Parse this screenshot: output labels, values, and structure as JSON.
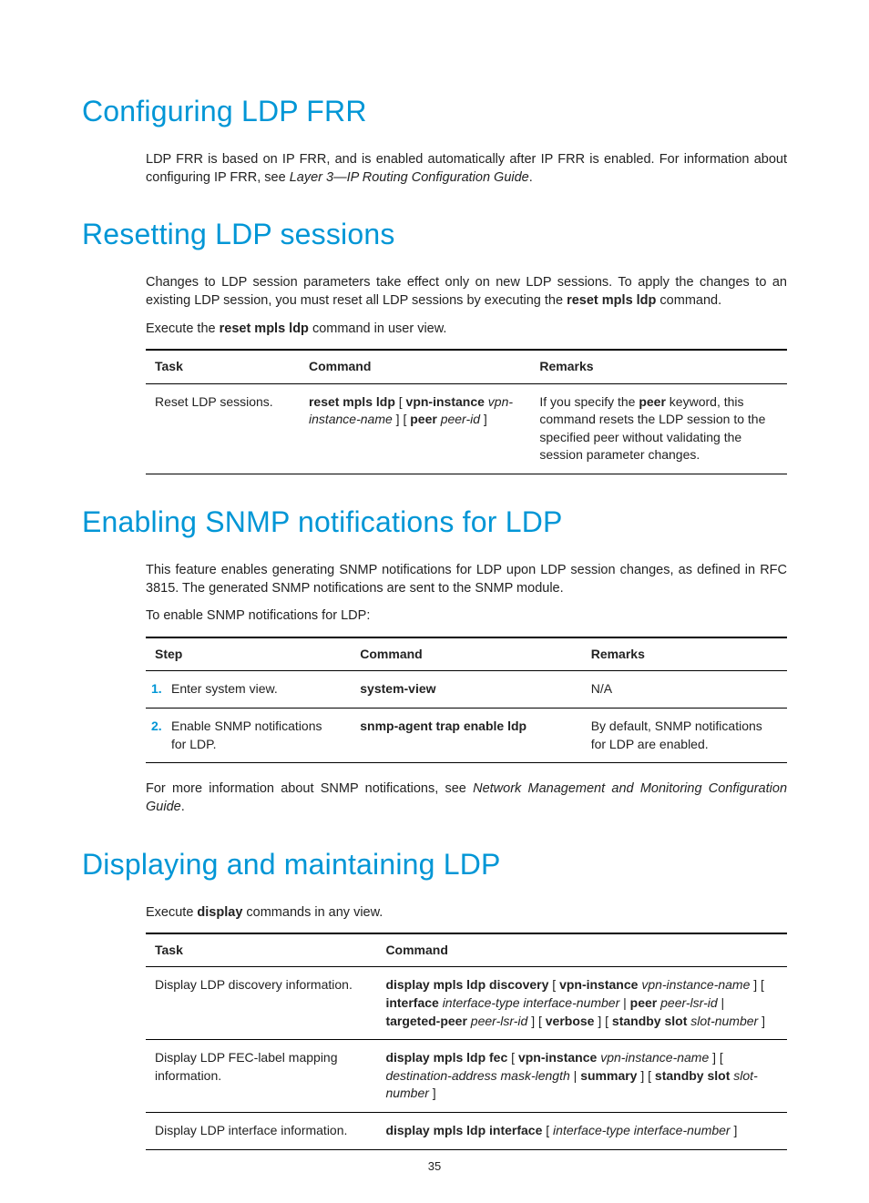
{
  "page_number": "35",
  "headings": {
    "h1": "Configuring LDP FRR",
    "h2": "Resetting LDP sessions",
    "h3": "Enabling SNMP notifications for LDP",
    "h4": "Displaying and maintaining LDP"
  },
  "paragraphs": {
    "frr_1a": "LDP FRR is based on IP FRR, and is enabled automatically after IP FRR is enabled. For information about configuring IP FRR, see ",
    "frr_1b": "Layer 3—IP Routing Configuration Guide",
    "frr_1c": ".",
    "reset_1a": "Changes to LDP session parameters take effect only on new LDP sessions. To apply the changes to an existing LDP session, you must reset all LDP sessions by executing the ",
    "reset_1b": "reset mpls ldp",
    "reset_1c": " command.",
    "reset_2a": "Execute the ",
    "reset_2b": "reset mpls ldp",
    "reset_2c": " command in user view.",
    "snmp_1": "This feature enables generating SNMP notifications for LDP upon LDP session changes, as defined in RFC 3815. The generated SNMP notifications are sent to the SNMP module.",
    "snmp_2": "To enable SNMP notifications for LDP:",
    "snmp_3a": "For more information about SNMP notifications, see ",
    "snmp_3b": "Network Management and Monitoring Configuration Guide",
    "snmp_3c": ".",
    "disp_1a": "Execute ",
    "disp_1b": "display",
    "disp_1c": " commands in any view."
  },
  "table1": {
    "headers": {
      "task": "Task",
      "command": "Command",
      "remarks": "Remarks"
    },
    "row1": {
      "task": "Reset LDP sessions.",
      "cmd_1": "reset mpls ldp",
      "cmd_2": " [ ",
      "cmd_3": "vpn-instance",
      "cmd_4": " ",
      "cmd_5": "vpn-instance-name",
      "cmd_6": " ] [ ",
      "cmd_7": "peer",
      "cmd_8": " ",
      "cmd_9": "peer-id",
      "cmd_10": " ]",
      "rem_a": "If you specify the ",
      "rem_b": "peer",
      "rem_c": " keyword, this command resets the LDP session to the specified peer without validating the session parameter changes."
    }
  },
  "table2": {
    "headers": {
      "step": "Step",
      "command": "Command",
      "remarks": "Remarks"
    },
    "rows": [
      {
        "num": "1.",
        "step": "Enter system view.",
        "cmd": "system-view",
        "remarks": "N/A"
      },
      {
        "num": "2.",
        "step": "Enable SNMP notifications for LDP.",
        "cmd": "snmp-agent trap enable ldp",
        "remarks": "By default, SNMP notifications for LDP are enabled."
      }
    ]
  },
  "table3": {
    "headers": {
      "task": "Task",
      "command": "Command"
    },
    "rows": [
      {
        "task": "Display LDP discovery information.",
        "parts": [
          {
            "b": "display mpls ldp discovery"
          },
          {
            "t": " [ "
          },
          {
            "b": "vpn-instance"
          },
          {
            "t": " "
          },
          {
            "i": "vpn-instance-name"
          },
          {
            "t": " ] [ "
          },
          {
            "b": "interface"
          },
          {
            "t": " "
          },
          {
            "i": "interface-type interface-number"
          },
          {
            "t": " | "
          },
          {
            "b": "peer"
          },
          {
            "t": " "
          },
          {
            "i": "peer-lsr-id"
          },
          {
            "t": " | "
          },
          {
            "b": "targeted-peer"
          },
          {
            "t": " "
          },
          {
            "i": "peer-lsr-id"
          },
          {
            "t": " ] [ "
          },
          {
            "b": "verbose"
          },
          {
            "t": " ] [ "
          },
          {
            "b": "standby slot"
          },
          {
            "t": " "
          },
          {
            "i": "slot-number"
          },
          {
            "t": " ]"
          }
        ]
      },
      {
        "task": "Display LDP FEC-label mapping information.",
        "parts": [
          {
            "b": "display mpls ldp fec"
          },
          {
            "t": " [ "
          },
          {
            "b": "vpn-instance"
          },
          {
            "t": " "
          },
          {
            "i": "vpn-instance-name"
          },
          {
            "t": " ] [ "
          },
          {
            "i": "destination-address mask-length"
          },
          {
            "t": " | "
          },
          {
            "b": "summary"
          },
          {
            "t": " ] [ "
          },
          {
            "b": "standby slot"
          },
          {
            "t": " "
          },
          {
            "i": "slot-number"
          },
          {
            "t": " ]"
          }
        ]
      },
      {
        "task": "Display LDP interface information.",
        "parts": [
          {
            "b": "display mpls ldp interface"
          },
          {
            "t": " [ "
          },
          {
            "i": "interface-type interface-number"
          },
          {
            "t": " ]"
          }
        ]
      }
    ]
  }
}
